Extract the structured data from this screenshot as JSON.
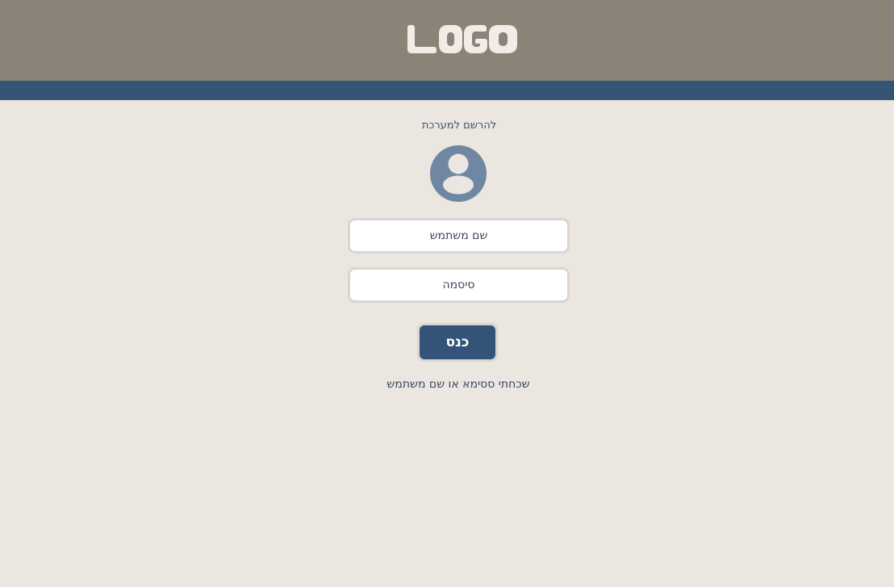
{
  "header": {
    "logo_text": "LOGO",
    "logo_color": "#f1ece6",
    "background": "#8b8377",
    "band_color": "#355577"
  },
  "login_form": {
    "register_link": "להרשם למערכת",
    "avatar_icon": "user-circle-icon",
    "username_placeholder": "שם משתמש",
    "password_placeholder": "סיסמה",
    "submit_label": "כנס",
    "forgot_link": "שכחתי ססימא או שם משתמש"
  },
  "colors": {
    "page_background": "#ebe6e0",
    "primary": "#335478",
    "avatar": "#6f87a3"
  }
}
